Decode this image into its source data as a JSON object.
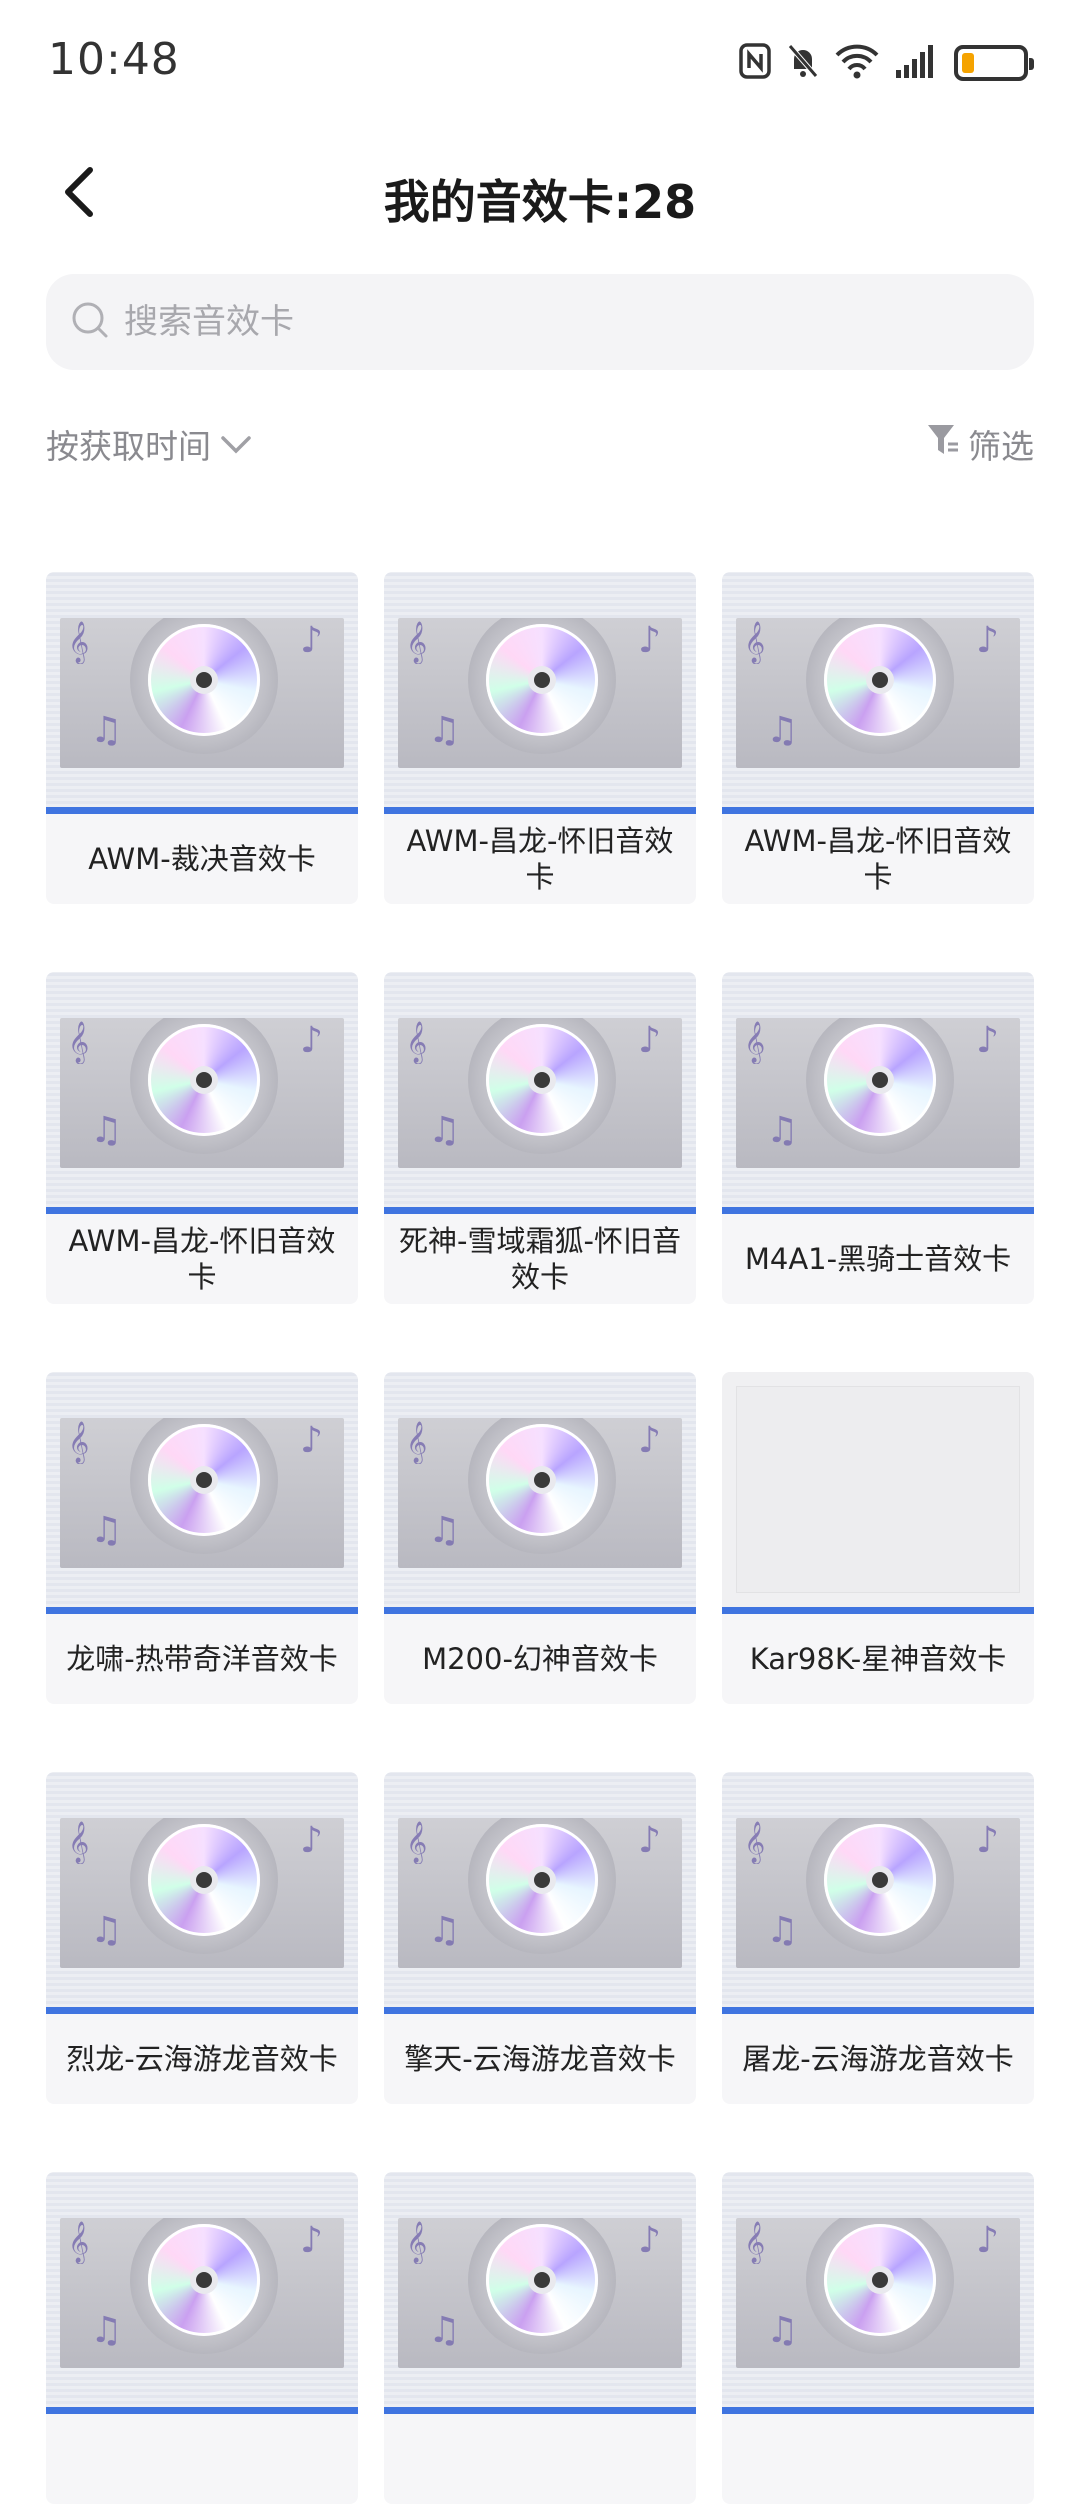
{
  "status_bar": {
    "time": "10:48",
    "icons": [
      "nfc-icon",
      "bell-mute-icon",
      "wifi-icon",
      "signal-icon",
      "battery-icon"
    ],
    "battery_level": 0.2,
    "battery_color": "#f5a300"
  },
  "header": {
    "title": "我的音效卡:28"
  },
  "search": {
    "placeholder": "搜索音效卡"
  },
  "toolbar": {
    "sort_label": "按获取时间",
    "filter_label": "筛选"
  },
  "cards": [
    {
      "label": "AWM-裁决音效卡",
      "has_image": true
    },
    {
      "label": "AWM-昌龙-怀旧音效卡",
      "has_image": true
    },
    {
      "label": "AWM-昌龙-怀旧音效卡",
      "has_image": true
    },
    {
      "label": "AWM-昌龙-怀旧音效卡",
      "has_image": true
    },
    {
      "label": "死神-雪域霜狐-怀旧音效卡",
      "has_image": true
    },
    {
      "label": "M4A1-黑骑士音效卡",
      "has_image": true
    },
    {
      "label": "龙啸-热带奇洋音效卡",
      "has_image": true
    },
    {
      "label": "M200-幻神音效卡",
      "has_image": true
    },
    {
      "label": "Kar98K-星神音效卡",
      "has_image": false
    },
    {
      "label": "烈龙-云海游龙音效卡",
      "has_image": true
    },
    {
      "label": "擎天-云海游龙音效卡",
      "has_image": true
    },
    {
      "label": "屠龙-云海游龙音效卡",
      "has_image": true
    },
    {
      "label": "",
      "has_image": true
    },
    {
      "label": "",
      "has_image": true
    },
    {
      "label": "",
      "has_image": true
    }
  ],
  "colors": {
    "accent": "#3f74e0",
    "card_bg": "#f6f6f8",
    "muted_text": "#8a8a8f"
  }
}
